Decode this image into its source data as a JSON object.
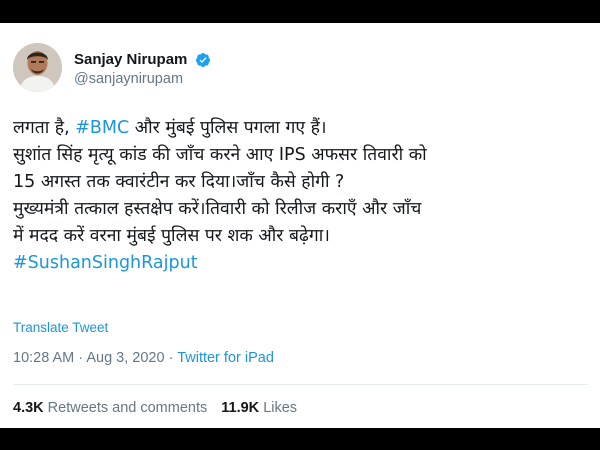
{
  "tweet": {
    "author": {
      "display_name": "Sanjay Nirupam",
      "handle": "@sanjaynirupam",
      "verified_icon": "verified-badge-icon",
      "verified_color": "#1da1f2"
    },
    "text_lines": [
      [
        "लगता है, ",
        "#BMC",
        " और मुंबई पुलिस पगला गए हैं।"
      ],
      "सुशांत सिंह मृत्यू कांड की जाँच करने आए IPS अफसर तिवारी को",
      "15 अगस्त तक क्वारंटीन  कर दिया।जाँच कैसे होगी ?",
      "मुख्यमंत्री तत्काल हस्तक्षेप करें।तिवारी को रिलीज कराएँ और जाँच",
      "में मदद करें वरना मुंबई पुलिस पर शक और बढ़ेगा।",
      "#SushanSinghRajput"
    ],
    "translate_label": "Translate Tweet",
    "timestamp": "10:28 AM · Aug 3, 2020",
    "separator": " · ",
    "source": "Twitter for iPad",
    "stats": {
      "retweets_count": "4.3K",
      "retweets_label": "Retweets and comments",
      "likes_count": "11.9K",
      "likes_label": "Likes"
    }
  },
  "colors": {
    "link": "#1b95e0",
    "text": "#14171a",
    "muted": "#657786",
    "divider": "#e6ecf0",
    "frame": "#000000"
  }
}
